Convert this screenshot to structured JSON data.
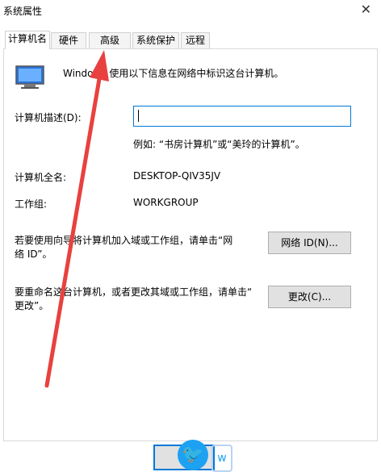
{
  "window": {
    "title": "系统属性",
    "close": "✕"
  },
  "tabs": [
    {
      "label": "计算机名"
    },
    {
      "label": "硬件"
    },
    {
      "label": "高级"
    },
    {
      "label": "系统保护"
    },
    {
      "label": "远程"
    }
  ],
  "panel": {
    "intro": "Windows 使用以下信息在网络中标识这台计算机。",
    "description_label": "计算机描述(D):",
    "description_value": "",
    "example": "例如: “书房计算机”或“美玲的计算机”。",
    "fullname_label": "计算机全名:",
    "fullname_value": "DESKTOP-QIV35JV",
    "workgroup_label": "工作组:",
    "workgroup_value": "WORKGROUP",
    "network_text_line1": "若要使用向导将计算机加入域或工作组，请单击“网",
    "network_text_line2": "络 ID”。",
    "network_button": "网络 ID(N)...",
    "rename_text_line1": "要重命名这台计算机，或者更改其域或工作组，请单击“",
    "rename_text_line2": "更改”。",
    "change_button": "更改(C)..."
  },
  "overlay": {
    "bird_icon": "twitter-bird",
    "arrow_color": "#e8413f"
  }
}
